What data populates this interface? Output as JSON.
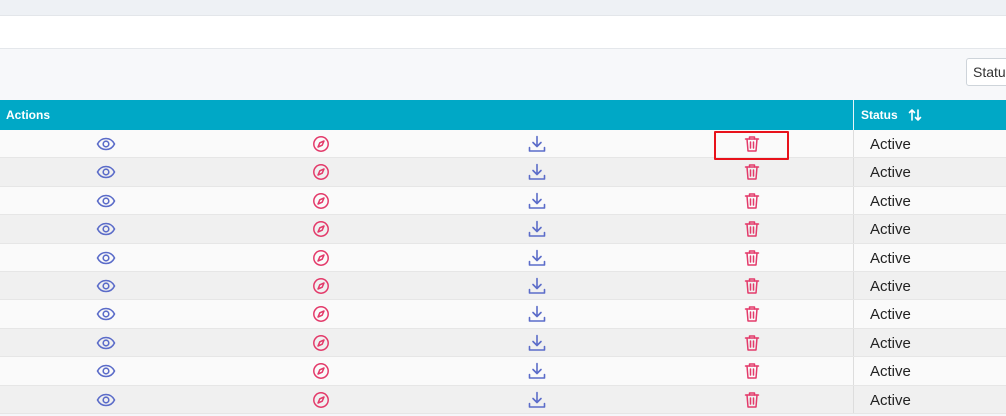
{
  "filter": {
    "status_label": "Status"
  },
  "table": {
    "headers": {
      "actions": "Actions",
      "status": "Status"
    },
    "rows": [
      {
        "status": "Active"
      },
      {
        "status": "Active"
      },
      {
        "status": "Active"
      },
      {
        "status": "Active"
      },
      {
        "status": "Active"
      },
      {
        "status": "Active"
      },
      {
        "status": "Active"
      },
      {
        "status": "Active"
      },
      {
        "status": "Active"
      },
      {
        "status": "Active"
      }
    ]
  },
  "icons": {
    "view": "eye-icon",
    "navigate": "compass-icon",
    "download": "download-icon",
    "delete": "trash-icon",
    "sort": "sort-icon"
  },
  "colors": {
    "header_bg": "#00a8c6",
    "view_icon": "#5b6cc9",
    "download_icon": "#5b6cc9",
    "navigate_icon": "#e33a6a",
    "delete_icon": "#e33a6a",
    "highlight": "#e8121b"
  },
  "highlight": {
    "row": 0,
    "target": "delete"
  }
}
